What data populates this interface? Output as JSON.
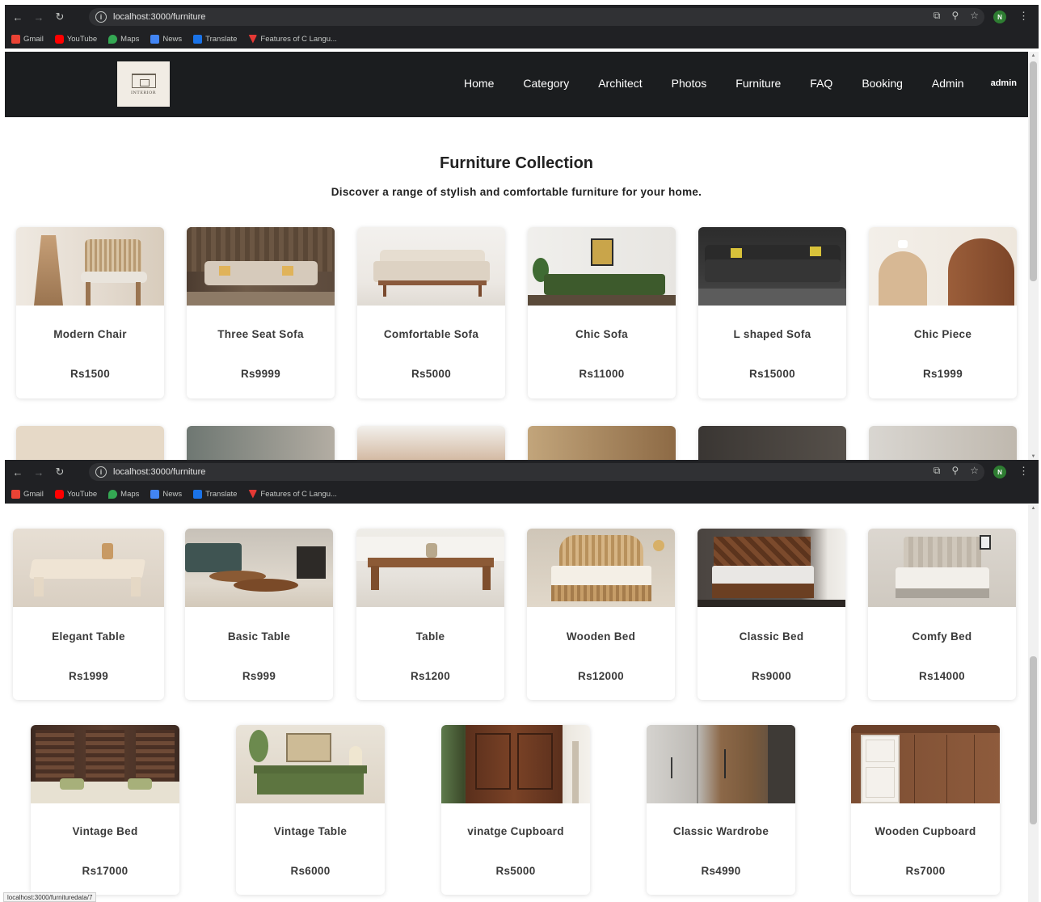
{
  "browser": {
    "url": "localhost:3000/furniture",
    "profile_initial": "N",
    "bookmarks": [
      "Gmail",
      "YouTube",
      "Maps",
      "News",
      "Translate",
      "Features of C Langu..."
    ]
  },
  "site": {
    "logo_text": "INTERIOR",
    "nav": [
      "Home",
      "Category",
      "Architect",
      "Photos",
      "Furniture",
      "FAQ",
      "Booking",
      "Admin"
    ],
    "user": "admin"
  },
  "page": {
    "title": "Furniture Collection",
    "subtitle": "Discover a range of stylish and comfortable furniture for your home."
  },
  "row1": [
    {
      "name": "Modern Chair",
      "price": "Rs1500"
    },
    {
      "name": "Three Seat Sofa",
      "price": "Rs9999"
    },
    {
      "name": "Comfortable Sofa",
      "price": "Rs5000"
    },
    {
      "name": "Chic Sofa",
      "price": "Rs11000"
    },
    {
      "name": "L shaped Sofa",
      "price": "Rs15000"
    },
    {
      "name": "Chic Piece",
      "price": "Rs1999"
    }
  ],
  "row2": [
    {
      "name": "Elegant Table",
      "price": "Rs1999"
    },
    {
      "name": "Basic Table",
      "price": "Rs999"
    },
    {
      "name": "Table",
      "price": "Rs1200"
    },
    {
      "name": "Wooden Bed",
      "price": "Rs12000"
    },
    {
      "name": "Classic Bed",
      "price": "Rs9000"
    },
    {
      "name": "Comfy Bed",
      "price": "Rs14000"
    }
  ],
  "row3": [
    {
      "name": "Vintage Bed",
      "price": "Rs17000"
    },
    {
      "name": "Vintage Table",
      "price": "Rs6000"
    },
    {
      "name": "vinatge Cupboard",
      "price": "Rs5000"
    },
    {
      "name": "Classic Wardrobe",
      "price": "Rs4990"
    },
    {
      "name": "Wooden Cupboard",
      "price": "Rs7000"
    }
  ],
  "status_bar": "localhost:3000/furnituredata/7"
}
